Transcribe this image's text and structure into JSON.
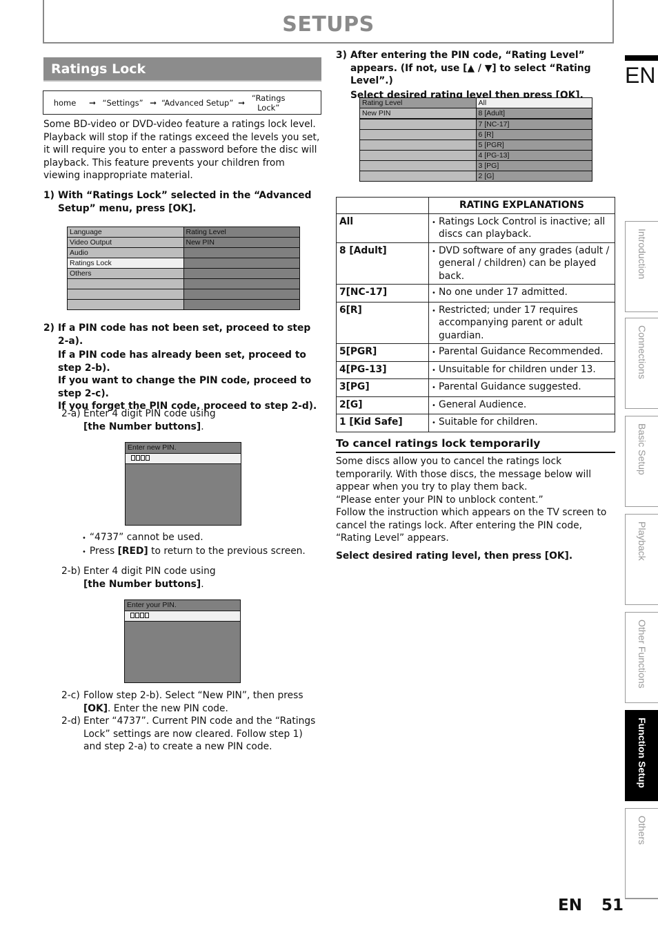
{
  "header": {
    "title": "SETUPS"
  },
  "section": {
    "title": "Ratings Lock"
  },
  "breadcrumb": [
    "home",
    "“Settings”",
    "“Advanced Setup”",
    "“Ratings Lock”"
  ],
  "breadcrumb_arrow": "➞",
  "intro": "Some BD-video or DVD-video feature a ratings lock level. Playback will stop if the ratings exceed the levels you set, it will require you to enter a password before the disc will playback. This feature prevents your children from viewing inappropriate material.",
  "step1": {
    "num": "1)",
    "text": "With “Ratings Lock” selected in the “Advanced Setup” menu, press [OK]."
  },
  "menu1": {
    "left": [
      "Language",
      "Video Output",
      "Audio",
      "Ratings Lock",
      "Others",
      "",
      "",
      ""
    ],
    "right": [
      "Rating Level",
      "New PIN",
      "",
      "",
      "",
      "",
      "",
      ""
    ],
    "selected_left_index": 3
  },
  "step2": {
    "num": "2)",
    "lines": [
      "If a PIN code has not been set, proceed to step 2-a).",
      "If a PIN code has already been set, proceed to step 2-b).",
      "If you want to change the PIN code, proceed to step 2-c).",
      "If you forget the PIN code, proceed to step 2-d)."
    ]
  },
  "step2a": {
    "label": "2-a)",
    "text": "Enter 4 digit PIN code using",
    "bold": "[the Number buttons]",
    "end": "."
  },
  "pin_new": {
    "prompt": "Enter new PIN."
  },
  "notes": [
    "“4737” cannot be used.",
    "Press ",
    "[RED]",
    " to return to the previous screen."
  ],
  "bullet": "•",
  "step2b": {
    "label": "2-b)",
    "text": "Enter 4 digit PIN code using",
    "bold": "[the Number buttons]",
    "end": "."
  },
  "pin_your": {
    "prompt": "Enter your PIN."
  },
  "step2c": {
    "label": "2-c)",
    "text1": "Follow step 2-b). Select “New PIN”, then press ",
    "bold": "[OK]",
    "text2": ". Enter the new PIN code."
  },
  "step2d": {
    "label": "2-d)",
    "text": "Enter “4737”. Current PIN code and the “Ratings Lock” settings are now cleared. Follow step 1) and step 2-a) to create a new PIN code."
  },
  "step3": {
    "num": "3)",
    "line1": "After entering the PIN code, “Rating Level” appears. (If not, use [▲ / ▼] to select “Rating Level”.)",
    "line2": "Select desired rating level then press [OK]."
  },
  "menu2": {
    "left": [
      "Rating Level",
      "New PIN",
      "",
      "",
      "",
      "",
      "",
      ""
    ],
    "right": [
      "All",
      "8 [Adult]",
      "7 [NC-17]",
      "6 [R]",
      "5 [PGR]",
      "4 [PG-13]",
      "3 [PG]",
      "2 [G]"
    ],
    "selected_right_index": 0
  },
  "rating_table": {
    "header": "RATING EXPLANATIONS",
    "rows": [
      {
        "level": "All",
        "desc": "Ratings Lock Control is inactive; all discs can playback."
      },
      {
        "level": "8 [Adult]",
        "desc": "DVD software of any grades (adult / general / children) can be played back."
      },
      {
        "level": "7[NC-17]",
        "desc": "No one under 17 admitted."
      },
      {
        "level": "6[R]",
        "desc": "Restricted; under 17 requires accompanying parent or adult guardian."
      },
      {
        "level": "5[PGR]",
        "desc": "Parental Guidance Recommended."
      },
      {
        "level": "4[PG-13]",
        "desc": "Unsuitable for children under 13."
      },
      {
        "level": "3[PG]",
        "desc": "Parental Guidance suggested."
      },
      {
        "level": "2[G]",
        "desc": "General Audience."
      },
      {
        "level": "1 [Kid Safe]",
        "desc": "Suitable for children."
      }
    ]
  },
  "cancel": {
    "title": "To cancel ratings lock temporarily",
    "p1": "Some discs allow you to cancel the ratings lock temporarily. With those discs, the message below will appear when you try to play them back.",
    "p2": "“Please enter your PIN to unblock content.”",
    "p3": "Follow the instruction which appears on the TV screen to cancel the ratings lock. After entering the PIN code, “Rating Level” appears.",
    "p4": "Select desired rating level, then press [OK]."
  },
  "side": {
    "lang": "EN",
    "tabs": [
      "Introduction",
      "Connections",
      "Basic Setup",
      "Playback",
      "Other Functions",
      "Function Setup",
      "Others"
    ],
    "active_tab": "Function Setup"
  },
  "footer": {
    "lang": "EN",
    "page": "51"
  }
}
